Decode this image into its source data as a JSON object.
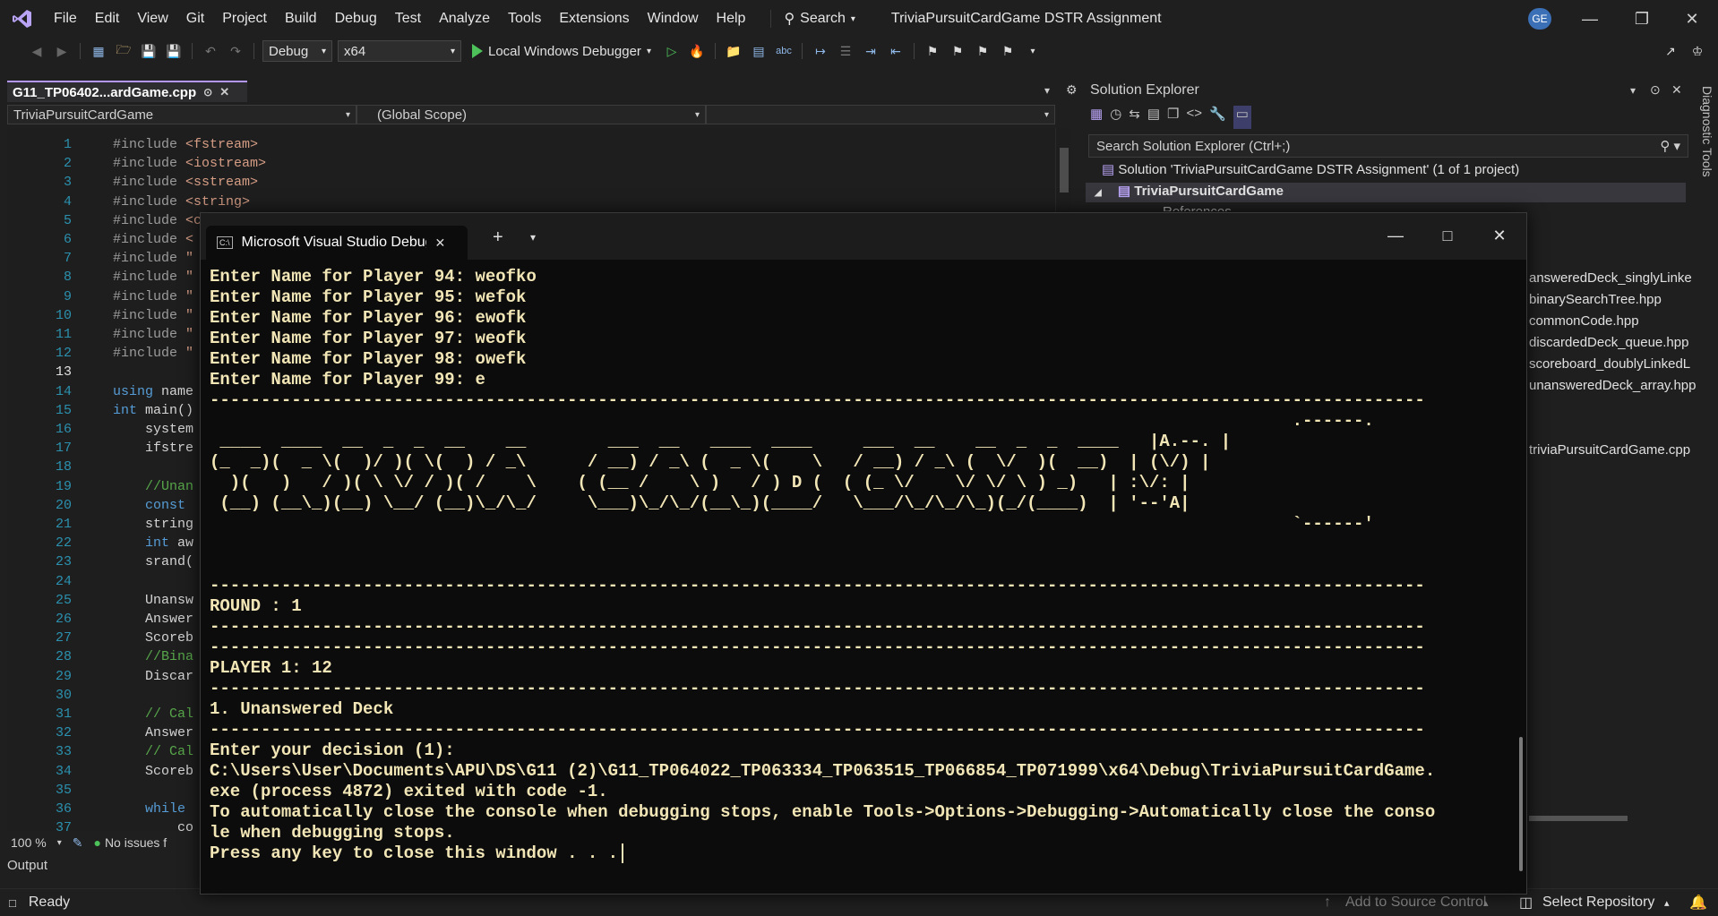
{
  "menubar": {
    "items": [
      "File",
      "Edit",
      "View",
      "Git",
      "Project",
      "Build",
      "Debug",
      "Test",
      "Analyze",
      "Tools",
      "Extensions",
      "Window",
      "Help"
    ],
    "search_label": "Search",
    "solution_title": "TriviaPursuitCardGame DSTR Assignment",
    "user_initials": "GE"
  },
  "toolbar": {
    "configuration": "Debug",
    "platform": "x64",
    "debugger_label": "Local Windows Debugger"
  },
  "editor": {
    "tab_label": "G11_TP06402...ardGame.cpp",
    "nav_project": "TriviaPursuitCardGame",
    "nav_scope": "(Global Scope)",
    "zoom": "100 %",
    "issues_label": "No issues f",
    "lines": [
      {
        "n": "1",
        "code": "#include <fstream>"
      },
      {
        "n": "2",
        "code": "#include <iostream>"
      },
      {
        "n": "3",
        "code": "#include <sstream>"
      },
      {
        "n": "4",
        "code": "#include <string>"
      },
      {
        "n": "5",
        "code": "#include <ctime>"
      },
      {
        "n": "6",
        "code": "#include <"
      },
      {
        "n": "7",
        "code": "#include \""
      },
      {
        "n": "8",
        "code": "#include \""
      },
      {
        "n": "9",
        "code": "#include \""
      },
      {
        "n": "10",
        "code": "#include \""
      },
      {
        "n": "11",
        "code": "#include \""
      },
      {
        "n": "12",
        "code": "#include \""
      },
      {
        "n": "13",
        "code": ""
      },
      {
        "n": "14",
        "code": "using name"
      },
      {
        "n": "15",
        "code": "int main()"
      },
      {
        "n": "16",
        "code": "    system"
      },
      {
        "n": "17",
        "code": "    ifstre"
      },
      {
        "n": "18",
        "code": ""
      },
      {
        "n": "19",
        "code": "    //Unan"
      },
      {
        "n": "20",
        "code": "    const "
      },
      {
        "n": "21",
        "code": "    string"
      },
      {
        "n": "22",
        "code": "    int aw"
      },
      {
        "n": "23",
        "code": "    srand("
      },
      {
        "n": "24",
        "code": ""
      },
      {
        "n": "25",
        "code": "    Unansw"
      },
      {
        "n": "26",
        "code": "    Answer"
      },
      {
        "n": "27",
        "code": "    Scoreb"
      },
      {
        "n": "28",
        "code": "    //Bina"
      },
      {
        "n": "29",
        "code": "    Discar"
      },
      {
        "n": "30",
        "code": ""
      },
      {
        "n": "31",
        "code": "    // Cal"
      },
      {
        "n": "32",
        "code": "    Answer"
      },
      {
        "n": "33",
        "code": "    // Cal"
      },
      {
        "n": "34",
        "code": "    Scoreb"
      },
      {
        "n": "35",
        "code": ""
      },
      {
        "n": "36",
        "code": "    while "
      },
      {
        "n": "37",
        "code": "        co"
      }
    ]
  },
  "output": {
    "title": "Output"
  },
  "statusbar": {
    "ready": "Ready",
    "source_control": "Add to Source Control",
    "repository": "Select Repository",
    "notifications": "1"
  },
  "solution_explorer": {
    "title": "Solution Explorer",
    "search_placeholder": "Search Solution Explorer (Ctrl+;)",
    "solution_label": "Solution 'TriviaPursuitCardGame DSTR Assignment' (1 of 1 project)",
    "project_label": "TriviaPursuitCardGame",
    "references_label": "References",
    "files": [
      "answeredDeck_singlyLinke",
      "binarySearchTree.hpp",
      "commonCode.hpp",
      "discardedDeck_queue.hpp",
      "scoreboard_doublyLinkedL",
      "unansweredDeck_array.hpp",
      "triviaPursuitCardGame.cpp"
    ],
    "diagnostic_tools": "Diagnostic Tools"
  },
  "console": {
    "tab_title": "Microsoft Visual Studio Debug Console",
    "lines": [
      "Enter Name for Player 94: weofko",
      "Enter Name for Player 95: wefok",
      "Enter Name for Player 96: ewofk",
      "Enter Name for Player 97: weofk",
      "Enter Name for Player 98: owefk",
      "Enter Name for Player 99: e",
      "-----------------------------------------------------------------------------------------------------------------------",
      "                                                                                                          .------.",
      " ____  ____  __  _  _  __    __        ___  __   ____  ____     ___  __    __  _  _  ____   |A.--. |",
      "(_  _)(  _ \\(  )/ )( \\(  ) / _\\      / __) / _\\ (  _ \\(    \\   / __) / _\\ (  \\/  )(  __)  | (\\/) |",
      "  )(   )   / )( \\ \\/ / )( /    \\    ( (__ /    \\ )   / ) D (  ( (_ \\/    \\/ \\/ \\ ) _)   | :\\/: |",
      " (__) (__\\_)(__) \\__/ (__)\\_/\\_/     \\___)\\_/\\_/(__\\_)(____/   \\___/\\_/\\_/\\_)(_/(____)  | '--'A|",
      "                                                                                                          `------'",
      "",
      "",
      "-----------------------------------------------------------------------------------------------------------------------",
      "ROUND : 1",
      "-----------------------------------------------------------------------------------------------------------------------",
      "-----------------------------------------------------------------------------------------------------------------------",
      "PLAYER 1: 12",
      "-----------------------------------------------------------------------------------------------------------------------",
      "1. Unanswered Deck",
      "-----------------------------------------------------------------------------------------------------------------------",
      "Enter your decision (1):",
      "C:\\Users\\User\\Documents\\APU\\DS\\G11 (2)\\G11_TP064022_TP063334_TP063515_TP066854_TP071999\\x64\\Debug\\TriviaPursuitCardGame.",
      "exe (process 4872) exited with code -1.",
      "To automatically close the console when debugging stops, enable Tools->Options->Debugging->Automatically close the conso",
      "le when debugging stops.",
      "Press any key to close this window . . ."
    ]
  }
}
